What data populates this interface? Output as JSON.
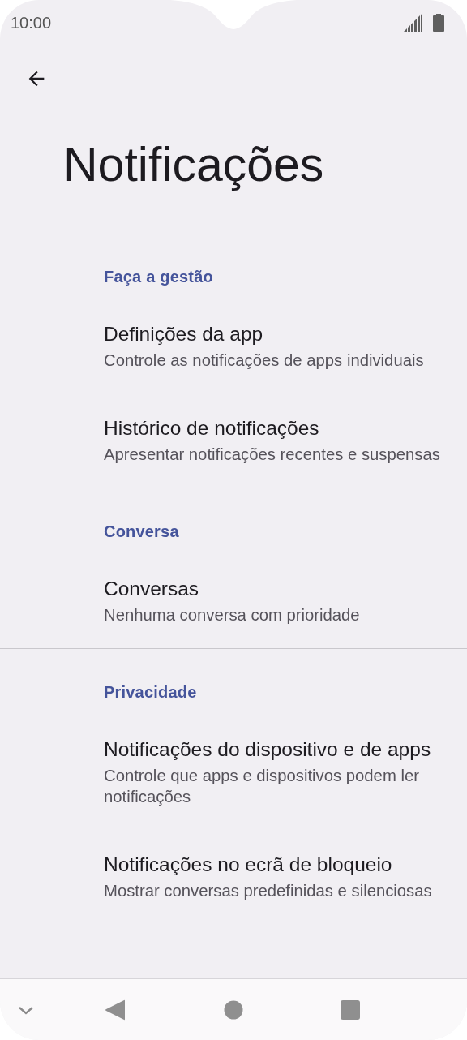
{
  "status_bar": {
    "time": "10:00"
  },
  "title": "Notificações",
  "sections": [
    {
      "header": "Faça a gestão",
      "items": [
        {
          "title": "Definições da app",
          "summary": "Controle as notificações de apps individuais"
        },
        {
          "title": "Histórico de notificações",
          "summary": "Apresentar notificações recentes e suspensas"
        }
      ]
    },
    {
      "header": "Conversa",
      "items": [
        {
          "title": "Conversas",
          "summary": "Nenhuma conversa com prioridade"
        }
      ]
    },
    {
      "header": "Privacidade",
      "items": [
        {
          "title": "Notificações do dispositivo e de apps",
          "summary": "Controle que apps e dispositivos podem ler notificações"
        },
        {
          "title": "Notificações no ecrã de bloqueio",
          "summary": "Mostrar conversas predefinidas e silenciosas"
        }
      ]
    }
  ]
}
